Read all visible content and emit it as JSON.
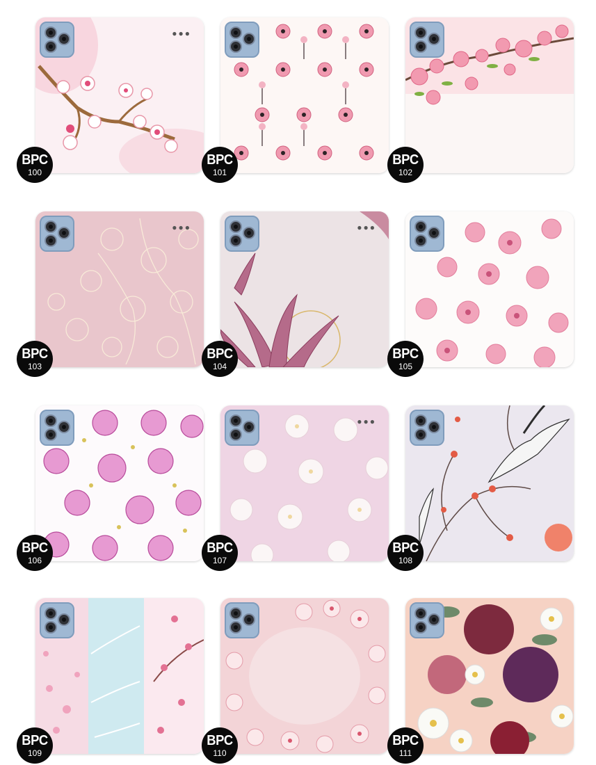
{
  "products": [
    {
      "code": "BPC",
      "number": "100",
      "design": "cherry-blossom-branch"
    },
    {
      "code": "BPC",
      "number": "101",
      "design": "pink-flower-pattern"
    },
    {
      "code": "BPC",
      "number": "102",
      "design": "peach-blossom-top"
    },
    {
      "code": "BPC",
      "number": "103",
      "design": "line-art-blossoms"
    },
    {
      "code": "BPC",
      "number": "104",
      "design": "pink-lily"
    },
    {
      "code": "BPC",
      "number": "105",
      "design": "sakura-cluster"
    },
    {
      "code": "BPC",
      "number": "106",
      "design": "purple-sakura"
    },
    {
      "code": "BPC",
      "number": "107",
      "design": "white-blossoms-on-lilac"
    },
    {
      "code": "BPC",
      "number": "108",
      "design": "cranes-and-plum"
    },
    {
      "code": "BPC",
      "number": "109",
      "design": "tri-panel-sakura"
    },
    {
      "code": "BPC",
      "number": "110",
      "design": "blossom-frame"
    },
    {
      "code": "BPC",
      "number": "111",
      "design": "peonies-and-roses"
    }
  ]
}
